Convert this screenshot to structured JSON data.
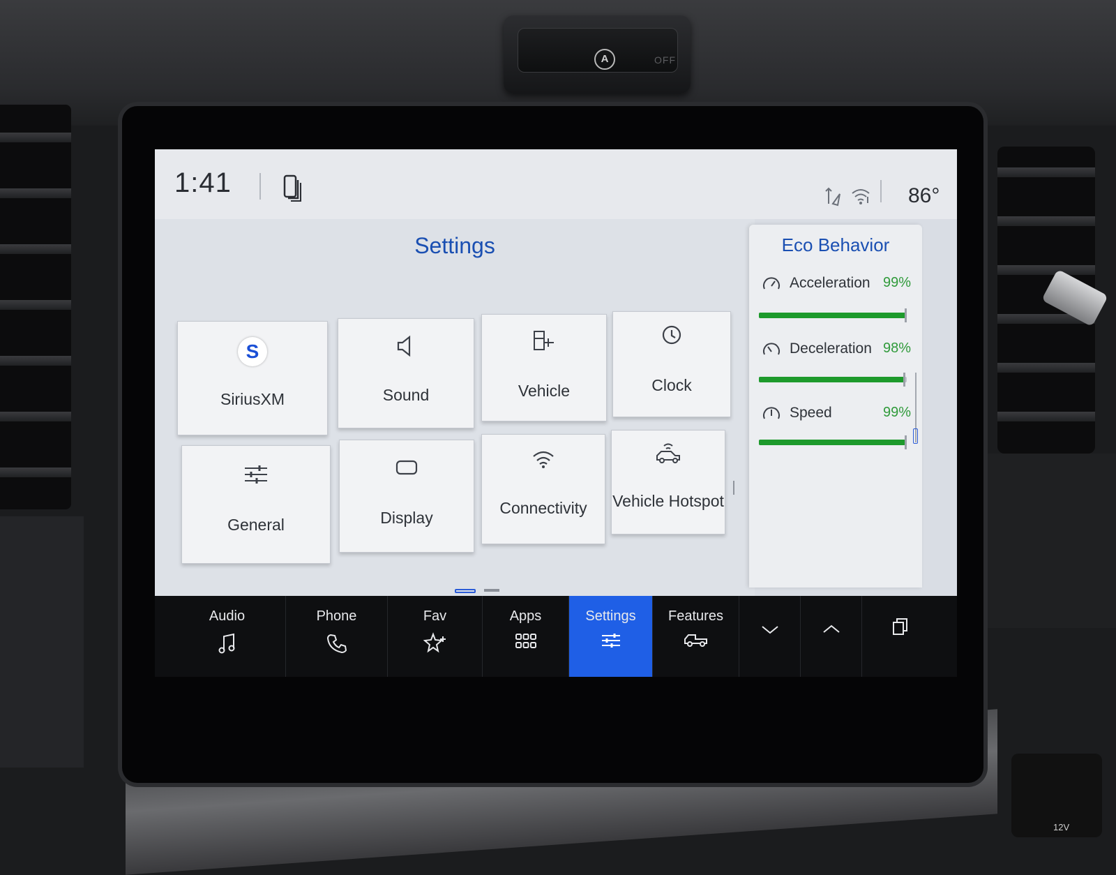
{
  "status": {
    "time": "1:41",
    "temperature": "86°"
  },
  "page": {
    "title": "Settings"
  },
  "tiles": [
    {
      "label": "SiriusXM",
      "icon": "siriusxm-icon"
    },
    {
      "label": "Sound",
      "icon": "speaker-icon"
    },
    {
      "label": "Vehicle",
      "icon": "vehicle-settings-icon"
    },
    {
      "label": "Clock",
      "icon": "clock-icon"
    },
    {
      "label": "General",
      "icon": "sliders-icon"
    },
    {
      "label": "Display",
      "icon": "display-icon"
    },
    {
      "label": "Connectivity",
      "icon": "wifi-icon"
    },
    {
      "label": "Vehicle Hotspot",
      "icon": "vehicle-hotspot-icon"
    }
  ],
  "eco": {
    "title": "Eco Behavior",
    "items": [
      {
        "label": "Acceleration",
        "percent": "99%",
        "value": 0.99
      },
      {
        "label": "Deceleration",
        "percent": "98%",
        "value": 0.98
      },
      {
        "label": "Speed",
        "percent": "99%",
        "value": 0.99
      }
    ]
  },
  "nav": {
    "items": [
      {
        "label": "Audio",
        "icon": "music-note-icon"
      },
      {
        "label": "Phone",
        "icon": "phone-icon"
      },
      {
        "label": "Fav",
        "icon": "star-plus-icon"
      },
      {
        "label": "Apps",
        "icon": "apps-grid-icon"
      },
      {
        "label": "Settings",
        "icon": "settings-sliders-icon"
      },
      {
        "label": "Features",
        "icon": "truck-icon"
      }
    ],
    "active": "Settings"
  },
  "hardware": {
    "hazard_off_label": "OFF",
    "auto_stop_label": "A",
    "port_label": "12V"
  },
  "colors": {
    "accent": "#1f5fe6",
    "title_blue": "#1a4fb2",
    "eco_green": "#1d9a2c"
  }
}
